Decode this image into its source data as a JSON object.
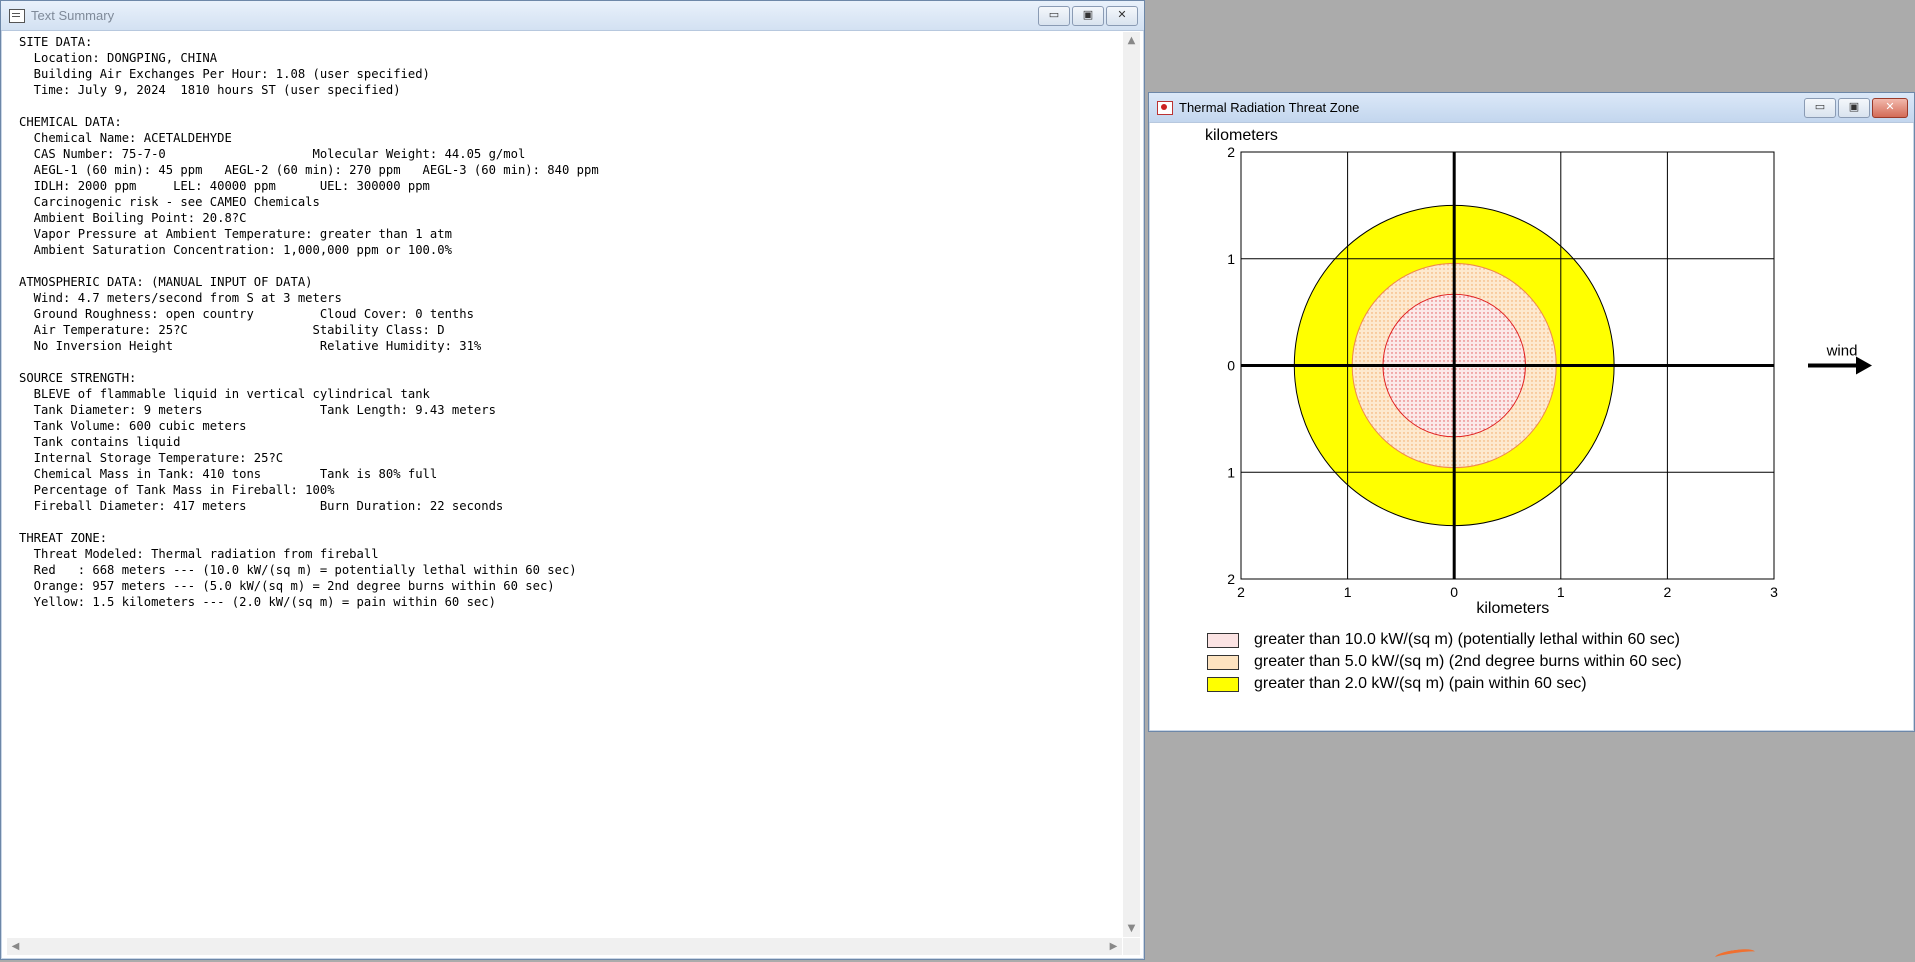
{
  "text_window": {
    "title": "Text Summary",
    "lines": [
      "SITE DATA:",
      "  Location: DONGPING, CHINA",
      "  Building Air Exchanges Per Hour: 1.08 (user specified)",
      "  Time: July 9, 2024  1810 hours ST (user specified)",
      "",
      "CHEMICAL DATA:",
      "  Chemical Name: ACETALDEHYDE",
      "  CAS Number: 75-7-0                    Molecular Weight: 44.05 g/mol",
      "  AEGL-1 (60 min): 45 ppm   AEGL-2 (60 min): 270 ppm   AEGL-3 (60 min): 840 ppm",
      "  IDLH: 2000 ppm     LEL: 40000 ppm      UEL: 300000 ppm",
      "  Carcinogenic risk - see CAMEO Chemicals",
      "  Ambient Boiling Point: 20.8?C",
      "  Vapor Pressure at Ambient Temperature: greater than 1 atm",
      "  Ambient Saturation Concentration: 1,000,000 ppm or 100.0%",
      "",
      "ATMOSPHERIC DATA: (MANUAL INPUT OF DATA)",
      "  Wind: 4.7 meters/second from S at 3 meters",
      "  Ground Roughness: open country         Cloud Cover: 0 tenths",
      "  Air Temperature: 25?C                 Stability Class: D",
      "  No Inversion Height                    Relative Humidity: 31%",
      "",
      "SOURCE STRENGTH:",
      "  BLEVE of flammable liquid in vertical cylindrical tank",
      "  Tank Diameter: 9 meters                Tank Length: 9.43 meters",
      "  Tank Volume: 600 cubic meters",
      "  Tank contains liquid",
      "  Internal Storage Temperature: 25?C",
      "  Chemical Mass in Tank: 410 tons        Tank is 80% full",
      "  Percentage of Tank Mass in Fireball: 100%",
      "  Fireball Diameter: 417 meters          Burn Duration: 22 seconds",
      "",
      "THREAT ZONE:",
      "  Threat Modeled: Thermal radiation from fireball",
      "  Red   : 668 meters --- (10.0 kW/(sq m) = potentially lethal within 60 sec)",
      "  Orange: 957 meters --- (5.0 kW/(sq m) = 2nd degree burns within 60 sec)",
      "  Yellow: 1.5 kilometers --- (2.0 kW/(sq m) = pain within 60 sec)"
    ]
  },
  "threat_window": {
    "title": "Thermal Radiation Threat Zone",
    "buttons": {
      "minimize": "▭",
      "maximize": "▣",
      "close": "✕"
    },
    "legend": [
      {
        "label": "greater than 10.0 kW/(sq m) (potentially lethal within 60 sec)",
        "color": "#f5c6c6"
      },
      {
        "label": "greater than 5.0 kW/(sq m) (2nd degree burns within 60 sec)",
        "color": "#fde0b8"
      },
      {
        "label": "greater than 2.0 kW/(sq m) (pain within 60 sec)",
        "color": "#ffff00"
      }
    ]
  },
  "chart_data": {
    "type": "scatter",
    "title": "",
    "xlabel": "kilometers",
    "ylabel": "kilometers",
    "xlim": [
      -2,
      3
    ],
    "ylim": [
      -2,
      2
    ],
    "x_tick_labels": [
      "2",
      "1",
      "0",
      "1",
      "2",
      "3"
    ],
    "y_tick_labels": [
      "2",
      "1",
      "0",
      "1",
      "2"
    ],
    "grid": true,
    "wind_label": "wind",
    "zones": [
      {
        "name": "Yellow",
        "radius_km": 1.5,
        "color": "#ffff00",
        "edge": "#000000"
      },
      {
        "name": "Orange",
        "radius_km": 0.957,
        "color": "#fde3c0",
        "edge": "#f08a4a"
      },
      {
        "name": "Red",
        "radius_km": 0.668,
        "color": "#f9d8d8",
        "edge": "#e02020"
      }
    ]
  }
}
